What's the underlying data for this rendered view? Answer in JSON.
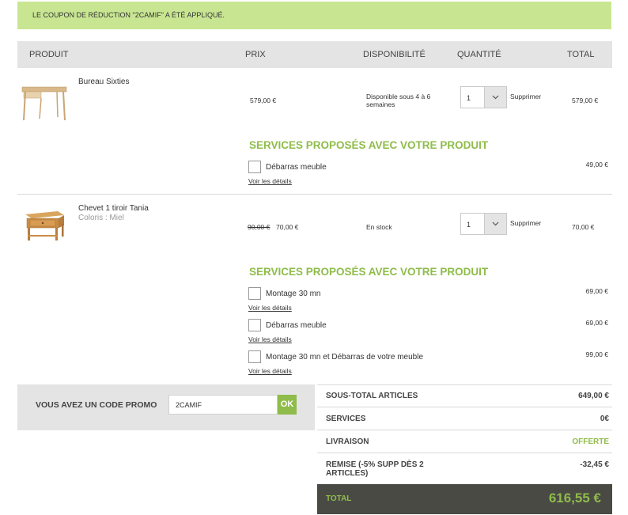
{
  "banner": {
    "message": "LE COUPON DE RÉDUCTION \"2CAMIF\" A ÉTÉ APPLIQUÉ."
  },
  "table_header": {
    "product": "PRODUIT",
    "price": "PRIX",
    "availability": "DISPONIBILITÉ",
    "quantity": "QUANTITÉ",
    "total": "TOTAL"
  },
  "items": [
    {
      "name": "Bureau Sixties",
      "price": "579,00 €",
      "availability": "Disponible sous 4 à 6 semaines",
      "quantity": "1",
      "remove_label": "Supprimer",
      "total": "579,00 €",
      "services_title": "SERVICES PROPOSÉS AVEC VOTRE PRODUIT",
      "services": [
        {
          "label": "Débarras meuble",
          "details": "Voir les détails",
          "price": "49,00 €"
        }
      ]
    },
    {
      "name": "Chevet 1 tiroir Tania",
      "color": "Coloris : Miel",
      "old_price": "90,00 €",
      "price": "70,00 €",
      "availability": "En stock",
      "quantity": "1",
      "remove_label": "Supprimer",
      "total": "70,00 €",
      "services_title": "SERVICES PROPOSÉS AVEC VOTRE PRODUIT",
      "services": [
        {
          "label": "Montage 30 mn",
          "details": "Voir les détails",
          "price": "69,00 €"
        },
        {
          "label": "Débarras meuble",
          "details": "Voir les détails",
          "price": "69,00 €"
        },
        {
          "label": "Montage 30 mn et Débarras de votre meuble",
          "details": "Voir les détails",
          "price": "99,00 €"
        }
      ]
    }
  ],
  "promo": {
    "label": "VOUS AVEZ UN CODE PROMO",
    "value": "2CAMIF",
    "button": "OK"
  },
  "summary": {
    "subtotal_label": "SOUS-TOTAL ARTICLES",
    "subtotal": "649,00 €",
    "services_label": "SERVICES",
    "services": "0€",
    "delivery_label": "LIVRAISON",
    "delivery": "OFFERTE",
    "discount_label": "REMISE (-5% SUPP DÈS 2 ARTICLES)",
    "discount": "-32,45 €",
    "total_label": "TOTAL",
    "total": "616,55 €"
  },
  "colors": {
    "accent_green": "#8fbc4a",
    "banner_bg": "#c8e692",
    "total_bg": "#4a4a45"
  }
}
